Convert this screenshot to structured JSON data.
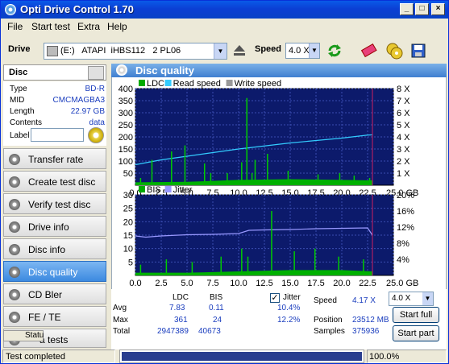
{
  "window": {
    "title": "Opti Drive Control 1.70"
  },
  "menu": [
    {
      "label": "File"
    },
    {
      "label": "Start test"
    },
    {
      "label": "Extra"
    },
    {
      "label": "Help"
    }
  ],
  "toolbar": {
    "drive_label": "Drive",
    "drive_value": "(E:)   ATAPI  iHBS112   2 PL06",
    "speed_label": "Speed",
    "speed_value": "4.0 X"
  },
  "disc": {
    "header": "Disc",
    "rows": [
      {
        "key": "Type",
        "value": "BD-R"
      },
      {
        "key": "MID",
        "value": "CMCMAGBA3"
      },
      {
        "key": "Length",
        "value": "22.97 GB"
      },
      {
        "key": "Contents",
        "value": "data"
      }
    ],
    "label_key": "Label"
  },
  "nav": [
    {
      "label": "Transfer rate"
    },
    {
      "label": "Create test disc"
    },
    {
      "label": "Verify test disc"
    },
    {
      "label": "Drive info"
    },
    {
      "label": "Disc info"
    },
    {
      "label": "Disc quality"
    },
    {
      "label": "CD Bler"
    },
    {
      "label": "FE / TE"
    },
    {
      "label": "a tests"
    },
    {
      "label": "Statu"
    }
  ],
  "panel": {
    "title": "Disc quality"
  },
  "chart_data": [
    {
      "type": "line",
      "legend": [
        "LDC",
        "Read speed",
        "Write speed"
      ],
      "legend_colors": [
        "#00aa00",
        "#33ccff",
        "#999999"
      ],
      "x_ticks": [
        0.0,
        2.5,
        5.0,
        7.5,
        10.0,
        12.5,
        15.0,
        17.5,
        20.0,
        22.5,
        25.0
      ],
      "x_tick_labels": [
        "0.0",
        "2.5",
        "5.0",
        "7.5",
        "10.0",
        "12.5",
        "15.0",
        "17.5",
        "20.0",
        "22.5",
        "25.0 GB"
      ],
      "xlim": [
        0,
        25
      ],
      "y_ticks_left": [
        "400",
        "350",
        "300",
        "250",
        "200",
        "150",
        "100",
        "50"
      ],
      "ylim_left": [
        0,
        400
      ],
      "y_ticks_right": [
        "8 X",
        "7 X",
        "6 X",
        "5 X",
        "4 X",
        "3 X",
        "2 X",
        "1 X"
      ],
      "ylim_right": [
        0,
        8
      ],
      "series": [
        {
          "name": "Read speed",
          "x": [
            0,
            2.5,
            5,
            7.5,
            10,
            12.5,
            15,
            17.5,
            20,
            22.5,
            22.97
          ],
          "y": [
            1.7,
            2.1,
            2.4,
            2.7,
            3.0,
            3.25,
            3.5,
            3.7,
            3.9,
            4.15,
            4.17
          ]
        },
        {
          "name": "LDC",
          "x": [
            0.5,
            1.6,
            3.5,
            4.8,
            6.7,
            7.3,
            8.9,
            10.3,
            10.8,
            11.3,
            11.6,
            12.8,
            14.8,
            17.7,
            19.8,
            21.2,
            22.7
          ],
          "y": [
            30,
            105,
            140,
            165,
            90,
            50,
            50,
            95,
            361,
            50,
            105,
            130,
            60,
            45,
            50,
            40,
            30
          ]
        },
        {
          "name": "LDC baseline",
          "x": [
            0,
            5,
            10,
            15,
            20,
            22.97
          ],
          "y": [
            12,
            14,
            22,
            25,
            22,
            20
          ]
        }
      ]
    },
    {
      "type": "line",
      "legend": [
        "BIS",
        "Jitter"
      ],
      "legend_colors": [
        "#00aa00",
        "#9999ff"
      ],
      "x_ticks": [
        0.0,
        2.5,
        5.0,
        7.5,
        10.0,
        12.5,
        15.0,
        17.5,
        20.0,
        22.5,
        25.0
      ],
      "x_tick_labels": [
        "0.0",
        "2.5",
        "5.0",
        "7.5",
        "10.0",
        "12.5",
        "15.0",
        "17.5",
        "20.0",
        "22.5",
        "25.0 GB"
      ],
      "xlim": [
        0,
        25
      ],
      "y_ticks_left": [
        "30",
        "25",
        "20",
        "15",
        "10",
        "5"
      ],
      "ylim_left": [
        0,
        30
      ],
      "y_ticks_right": [
        "20%",
        "16%",
        "12%",
        "8%",
        "4%"
      ],
      "ylim_right": [
        0,
        20
      ],
      "series": [
        {
          "name": "Jitter",
          "x": [
            0,
            1,
            2.5,
            5,
            7.5,
            10,
            11,
            12.5,
            15,
            17.5,
            20,
            22.5,
            22.97
          ],
          "y": [
            9.8,
            9.5,
            9.8,
            10.1,
            10.2,
            10.4,
            11.2,
            11.3,
            11.4,
            11.6,
            11.7,
            11.8,
            10.0
          ]
        },
        {
          "name": "BIS",
          "x": [
            0.5,
            3,
            5.5,
            8.3,
            10.3,
            10.9,
            13.2,
            15.4,
            17.4,
            19.7,
            22.1
          ],
          "y": [
            4,
            6,
            5,
            7,
            10,
            7,
            24,
            9,
            10,
            7,
            6
          ]
        },
        {
          "name": "BIS baseline",
          "x": [
            0,
            5,
            10,
            15,
            20,
            22.97
          ],
          "y": [
            1,
            1,
            1.5,
            2,
            2,
            1.5
          ]
        }
      ]
    }
  ],
  "stats": {
    "col_ldc": "LDC",
    "col_bis": "BIS",
    "rows": [
      {
        "label": "Avg",
        "ldc": "7.83",
        "bis": "0.11",
        "jitter": "10.4%"
      },
      {
        "label": "Max",
        "ldc": "361",
        "bis": "24",
        "jitter": "12.2%"
      },
      {
        "label": "Total",
        "ldc": "2947389",
        "bis": "40673"
      }
    ],
    "jitter_label": "Jitter",
    "jitter_checked": true,
    "speed_label": "Speed",
    "speed_value": "4.17 X",
    "speed_select": "4.0 X",
    "position_label": "Position",
    "position_value": "23512 MB",
    "samples_label": "Samples",
    "samples_value": "375936",
    "start_full": "Start full",
    "start_part": "Start part"
  },
  "status": {
    "text": "Test completed",
    "percent": "100.0%",
    "progress": 1.0
  }
}
